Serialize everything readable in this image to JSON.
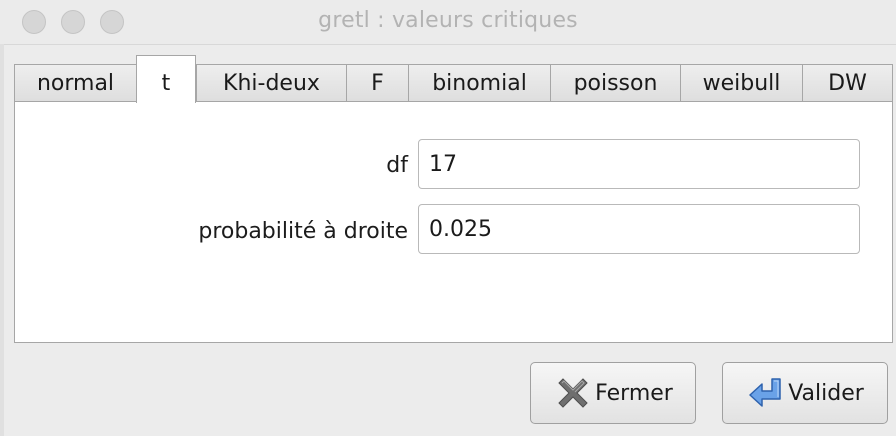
{
  "window": {
    "title": "gretl : valeurs critiques"
  },
  "tabs": [
    {
      "label": "normal",
      "active": false
    },
    {
      "label": "t",
      "active": true
    },
    {
      "label": "Khi-deux",
      "active": false
    },
    {
      "label": "F",
      "active": false
    },
    {
      "label": "binomial",
      "active": false
    },
    {
      "label": "poisson",
      "active": false
    },
    {
      "label": "weibull",
      "active": false
    },
    {
      "label": "DW",
      "active": false
    }
  ],
  "form": {
    "df_label": "df",
    "df_value": "17",
    "prob_label": "probabilité à droite",
    "prob_value": "0.025"
  },
  "buttons": {
    "close_label": "Fermer",
    "close_icon": "close-x-icon",
    "ok_label": "Valider",
    "ok_icon": "enter-arrow-icon"
  },
  "colors": {
    "icon_blue": "#3d7fd6",
    "icon_grey": "#6f6f6f"
  }
}
